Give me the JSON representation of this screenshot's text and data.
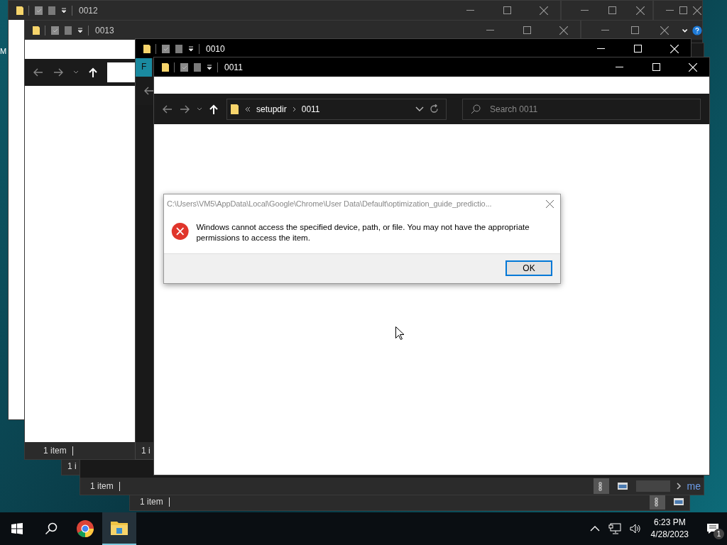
{
  "desktop": {
    "icon_label": "M"
  },
  "windows": [
    {
      "kind": "inactive",
      "title": "0012"
    },
    {
      "kind": "inactive"
    },
    {
      "kind": "inactive"
    },
    {
      "kind": "inactive",
      "help_button": true
    },
    {
      "kind": "inactive",
      "status": "1 i"
    },
    {
      "kind": "inactive",
      "status": "1 item"
    },
    {
      "kind": "inactive",
      "status": "1 item",
      "status_link": "me"
    },
    {
      "kind": "inactive",
      "title": "0013",
      "status": "1 item"
    },
    {
      "kind": "active",
      "title": "0010",
      "status": "1 i",
      "ribbon_tab": "F"
    },
    {
      "kind": "active",
      "title": "0011",
      "breadcrumb": [
        "setupdir",
        "0011"
      ],
      "search": {
        "placeholder": "Search 0011"
      }
    }
  ],
  "dialog": {
    "title": "C:\\Users\\VM5\\AppData\\Local\\Google\\Chrome\\User Data\\Default\\optimization_guide_predictio...",
    "message": "Windows cannot access the specified device, path, or file. You may not have the appropriate permissions to access the item.",
    "buttons": [
      "OK"
    ]
  },
  "taskbar": {
    "time": "6:23 PM",
    "date": "4/28/2023",
    "notification_count": "1"
  }
}
